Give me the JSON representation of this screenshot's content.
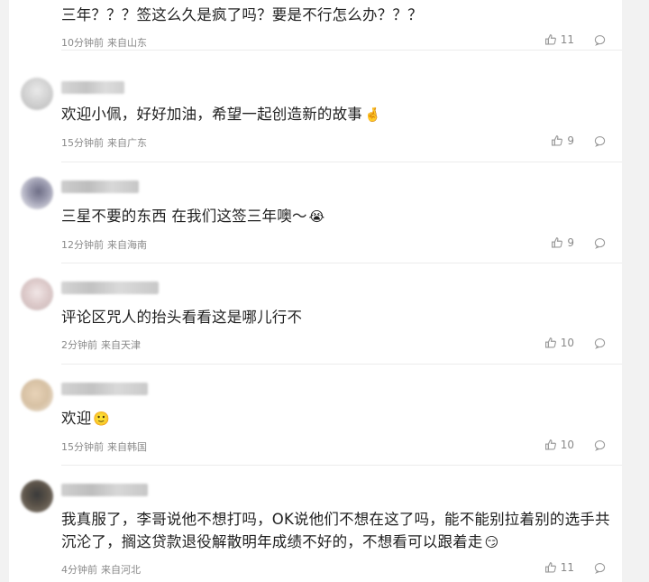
{
  "comments": [
    {
      "text": "三年？？？签这么久是疯了吗？要是不行怎么办？？？",
      "emoji": "",
      "time": "10分钟前",
      "location": "来自山东",
      "likes": "11"
    },
    {
      "text": "欢迎小佩，好好加油，希望一起创造新的故事",
      "emoji": "🤞",
      "time": "15分钟前",
      "location": "来自广东",
      "likes": "9"
    },
    {
      "text": "三星不要的东西 在我们这签三年噢～",
      "emoji": "😭",
      "time": "12分钟前",
      "location": "来自海南",
      "likes": "9"
    },
    {
      "text": "评论区咒人的抬头看看这是哪儿行不",
      "emoji": "",
      "time": "2分钟前",
      "location": "来自天津",
      "likes": "10"
    },
    {
      "text": "欢迎",
      "emoji": "🙂",
      "time": "15分钟前",
      "location": "来自韩国",
      "likes": "10"
    },
    {
      "text": "我真服了，李哥说他不想打吗，OK说他们不想在这了吗，能不能别拉着别的选手共沉沦了，搁这贷款退役解散明年成绩不好的，不想看可以跟着走",
      "emoji": "😏",
      "time": "4分钟前",
      "location": "来自河北",
      "likes": "11"
    }
  ]
}
